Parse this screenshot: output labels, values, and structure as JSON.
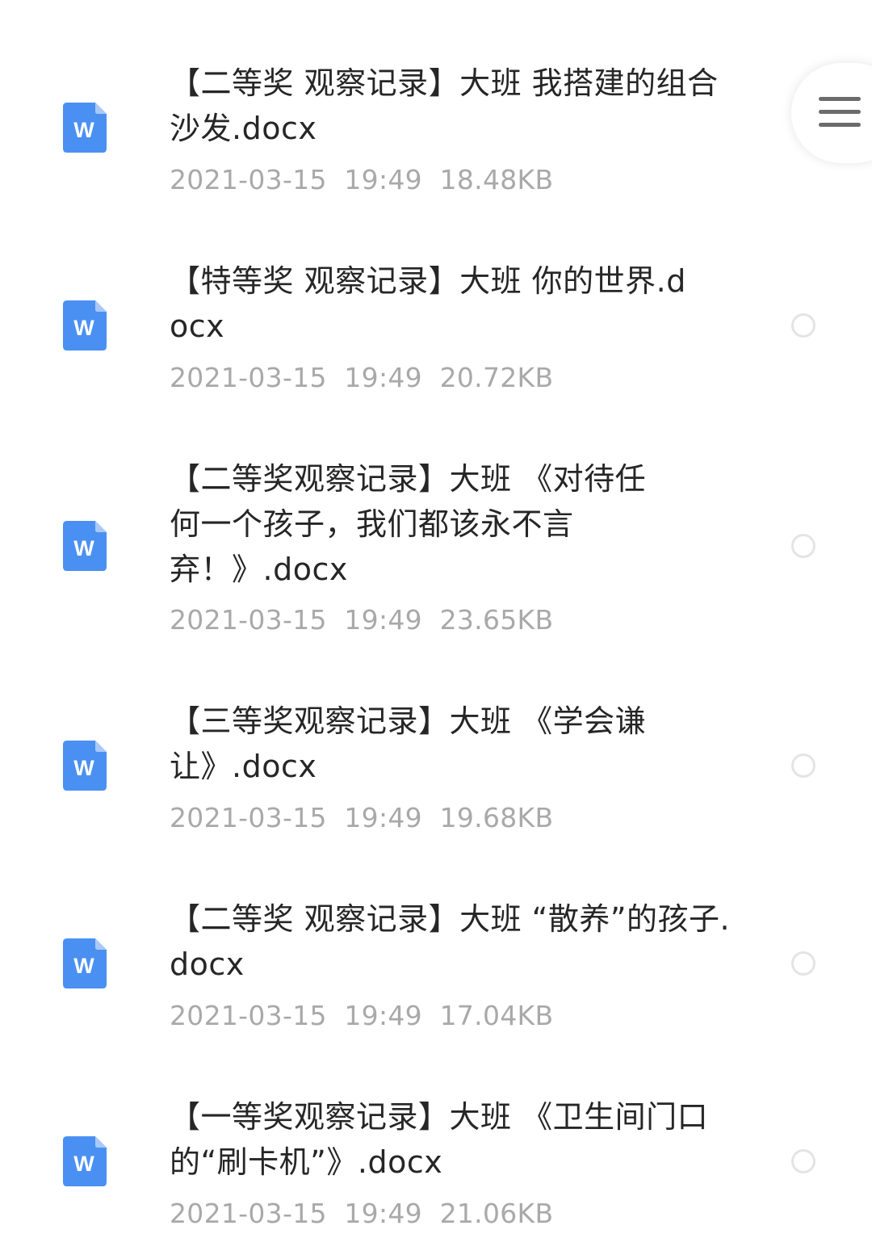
{
  "files": [
    {
      "name": "【二等奖 观察记录】大班 我搭建的组合沙发.docx",
      "date": "2021-03-15",
      "time": "19:49",
      "size": "18.48KB",
      "icon": "word-doc-icon",
      "icon_letter": "W"
    },
    {
      "name": "【特等奖 观察记录】大班 你的世界.docx",
      "date": "2021-03-15",
      "time": "19:49",
      "size": "20.72KB",
      "icon": "word-doc-icon",
      "icon_letter": "W"
    },
    {
      "name": "【二等奖观察记录】大班 《对待任何一个孩子，我们都该永不言弃！》.docx",
      "date": "2021-03-15",
      "time": "19:49",
      "size": "23.65KB",
      "icon": "word-doc-icon",
      "icon_letter": "W"
    },
    {
      "name": "【三等奖观察记录】大班 《学会谦让》.docx",
      "date": "2021-03-15",
      "time": "19:49",
      "size": "19.68KB",
      "icon": "word-doc-icon",
      "icon_letter": "W"
    },
    {
      "name": "【二等奖 观察记录】大班 “散养”的孩子.docx",
      "date": "2021-03-15",
      "time": "19:49",
      "size": "17.04KB",
      "icon": "word-doc-icon",
      "icon_letter": "W"
    },
    {
      "name": "【一等奖观察记录】大班 《卫生间门口的“刷卡机”》.docx",
      "date": "2021-03-15",
      "time": "19:49",
      "size": "21.06KB",
      "icon": "word-doc-icon",
      "icon_letter": "W"
    }
  ],
  "menu": {
    "icon": "hamburger-menu-icon"
  },
  "colors": {
    "icon_blue": "#4a90f2",
    "icon_fold": "#a9c9fa",
    "title_text": "#262626",
    "meta_text": "#a9a9a9",
    "radio_border": "#e4e4e4"
  }
}
